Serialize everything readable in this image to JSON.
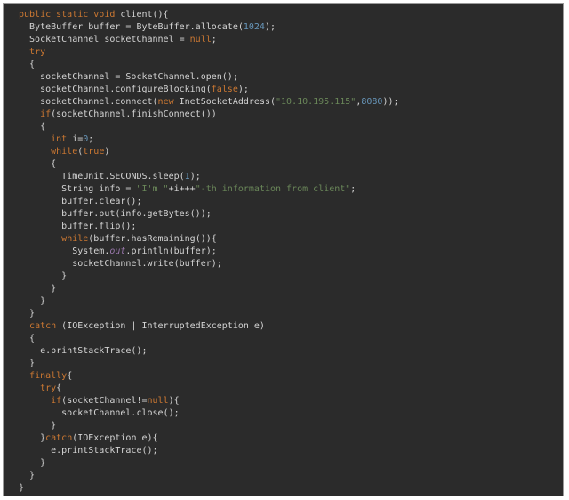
{
  "colors": {
    "background": "#2b2b2b",
    "plain": "#d4d4d4",
    "keyword": "#cc7832",
    "string": "#6a8759",
    "number": "#6897bb",
    "field": "#9876aa"
  },
  "code_lines": [
    [
      {
        "t": "public static void ",
        "k": "kw"
      },
      {
        "t": "client(){",
        "k": "plain"
      }
    ],
    [
      {
        "t": "  ByteBuffer buffer = ByteBuffer.allocate(",
        "k": "plain"
      },
      {
        "t": "1024",
        "k": "num"
      },
      {
        "t": ");",
        "k": "plain"
      }
    ],
    [
      {
        "t": "  SocketChannel socketChannel = ",
        "k": "plain"
      },
      {
        "t": "null",
        "k": "kw"
      },
      {
        "t": ";",
        "k": "plain"
      }
    ],
    [
      {
        "t": "  ",
        "k": "plain"
      },
      {
        "t": "try",
        "k": "kw"
      }
    ],
    [
      {
        "t": "  {",
        "k": "plain"
      }
    ],
    [
      {
        "t": "    socketChannel = SocketChannel.open();",
        "k": "plain"
      }
    ],
    [
      {
        "t": "    socketChannel.configureBlocking(",
        "k": "plain"
      },
      {
        "t": "false",
        "k": "kw"
      },
      {
        "t": ");",
        "k": "plain"
      }
    ],
    [
      {
        "t": "    socketChannel.connect(",
        "k": "plain"
      },
      {
        "t": "new ",
        "k": "kw"
      },
      {
        "t": "InetSocketAddress(",
        "k": "plain"
      },
      {
        "t": "\"10.10.195.115\"",
        "k": "str"
      },
      {
        "t": ",",
        "k": "plain"
      },
      {
        "t": "8080",
        "k": "num"
      },
      {
        "t": "));",
        "k": "plain"
      }
    ],
    [
      {
        "t": "    ",
        "k": "plain"
      },
      {
        "t": "if",
        "k": "kw"
      },
      {
        "t": "(socketChannel.finishConnect())",
        "k": "plain"
      }
    ],
    [
      {
        "t": "    {",
        "k": "plain"
      }
    ],
    [
      {
        "t": "      ",
        "k": "plain"
      },
      {
        "t": "int ",
        "k": "kw"
      },
      {
        "t": "i=",
        "k": "plain"
      },
      {
        "t": "0",
        "k": "num"
      },
      {
        "t": ";",
        "k": "plain"
      }
    ],
    [
      {
        "t": "      ",
        "k": "plain"
      },
      {
        "t": "while",
        "k": "kw"
      },
      {
        "t": "(",
        "k": "plain"
      },
      {
        "t": "true",
        "k": "kw"
      },
      {
        "t": ")",
        "k": "plain"
      }
    ],
    [
      {
        "t": "      {",
        "k": "plain"
      }
    ],
    [
      {
        "t": "        TimeUnit.",
        "k": "plain"
      },
      {
        "t": "SECONDS",
        "k": "plain"
      },
      {
        "t": ".sleep(",
        "k": "plain"
      },
      {
        "t": "1",
        "k": "num"
      },
      {
        "t": ");",
        "k": "plain"
      }
    ],
    [
      {
        "t": "        String info = ",
        "k": "plain"
      },
      {
        "t": "\"I'm \"",
        "k": "str"
      },
      {
        "t": "+i+++",
        "k": "plain"
      },
      {
        "t": "\"-th information from client\"",
        "k": "str"
      },
      {
        "t": ";",
        "k": "plain"
      }
    ],
    [
      {
        "t": "        buffer.clear();",
        "k": "plain"
      }
    ],
    [
      {
        "t": "        buffer.put(info.getBytes());",
        "k": "plain"
      }
    ],
    [
      {
        "t": "        buffer.flip();",
        "k": "plain"
      }
    ],
    [
      {
        "t": "        ",
        "k": "plain"
      },
      {
        "t": "while",
        "k": "kw"
      },
      {
        "t": "(buffer.hasRemaining()){",
        "k": "plain"
      }
    ],
    [
      {
        "t": "          System.",
        "k": "plain"
      },
      {
        "t": "out",
        "k": "field"
      },
      {
        "t": ".println(buffer);",
        "k": "plain"
      }
    ],
    [
      {
        "t": "          socketChannel.write(buffer);",
        "k": "plain"
      }
    ],
    [
      {
        "t": "        }",
        "k": "plain"
      }
    ],
    [
      {
        "t": "      }",
        "k": "plain"
      }
    ],
    [
      {
        "t": "    }",
        "k": "plain"
      }
    ],
    [
      {
        "t": "  }",
        "k": "plain"
      }
    ],
    [
      {
        "t": "  ",
        "k": "plain"
      },
      {
        "t": "catch ",
        "k": "kw"
      },
      {
        "t": "(IOException | InterruptedException e)",
        "k": "plain"
      }
    ],
    [
      {
        "t": "  {",
        "k": "plain"
      }
    ],
    [
      {
        "t": "    e.printStackTrace();",
        "k": "plain"
      }
    ],
    [
      {
        "t": "  }",
        "k": "plain"
      }
    ],
    [
      {
        "t": "  ",
        "k": "plain"
      },
      {
        "t": "finally",
        "k": "kw"
      },
      {
        "t": "{",
        "k": "plain"
      }
    ],
    [
      {
        "t": "    ",
        "k": "plain"
      },
      {
        "t": "try",
        "k": "kw"
      },
      {
        "t": "{",
        "k": "plain"
      }
    ],
    [
      {
        "t": "      ",
        "k": "plain"
      },
      {
        "t": "if",
        "k": "kw"
      },
      {
        "t": "(socketChannel!=",
        "k": "plain"
      },
      {
        "t": "null",
        "k": "kw"
      },
      {
        "t": "){",
        "k": "plain"
      }
    ],
    [
      {
        "t": "        socketChannel.close();",
        "k": "plain"
      }
    ],
    [
      {
        "t": "      }",
        "k": "plain"
      }
    ],
    [
      {
        "t": "    }",
        "k": "plain"
      },
      {
        "t": "catch",
        "k": "kw"
      },
      {
        "t": "(IOException e){",
        "k": "plain"
      }
    ],
    [
      {
        "t": "      e.printStackTrace();",
        "k": "plain"
      }
    ],
    [
      {
        "t": "    }",
        "k": "plain"
      }
    ],
    [
      {
        "t": "  }",
        "k": "plain"
      }
    ],
    [
      {
        "t": "}",
        "k": "plain"
      }
    ]
  ]
}
